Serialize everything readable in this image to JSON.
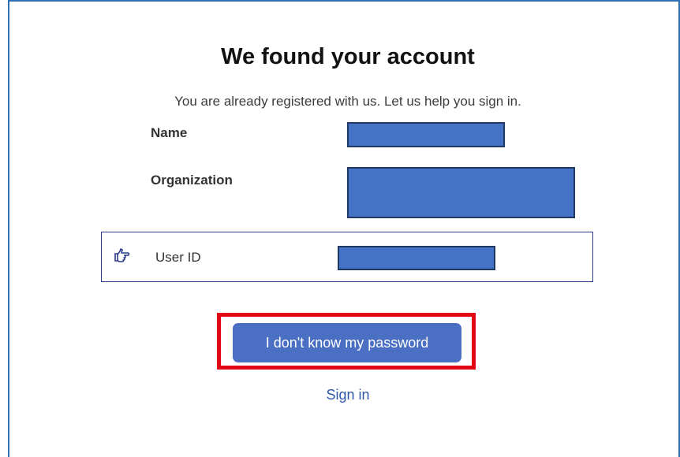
{
  "dialog": {
    "title": "We found your account",
    "subtitle": "You are already registered with us. Let us help you sign in."
  },
  "fields": {
    "name_label": "Name",
    "organization_label": "Organization",
    "user_id_label": "User ID"
  },
  "actions": {
    "forgot_password_label": "I don't know my password",
    "sign_in_label": "Sign in"
  },
  "icons": {
    "user_id_icon": "pointing-hand-icon"
  },
  "colors": {
    "frame_border": "#2e6fb5",
    "redaction_fill": "#4472c4",
    "redaction_border": "#1f3864",
    "primary_button": "#4a6fc3",
    "highlight_border": "#e30613",
    "link": "#2f56a8"
  }
}
